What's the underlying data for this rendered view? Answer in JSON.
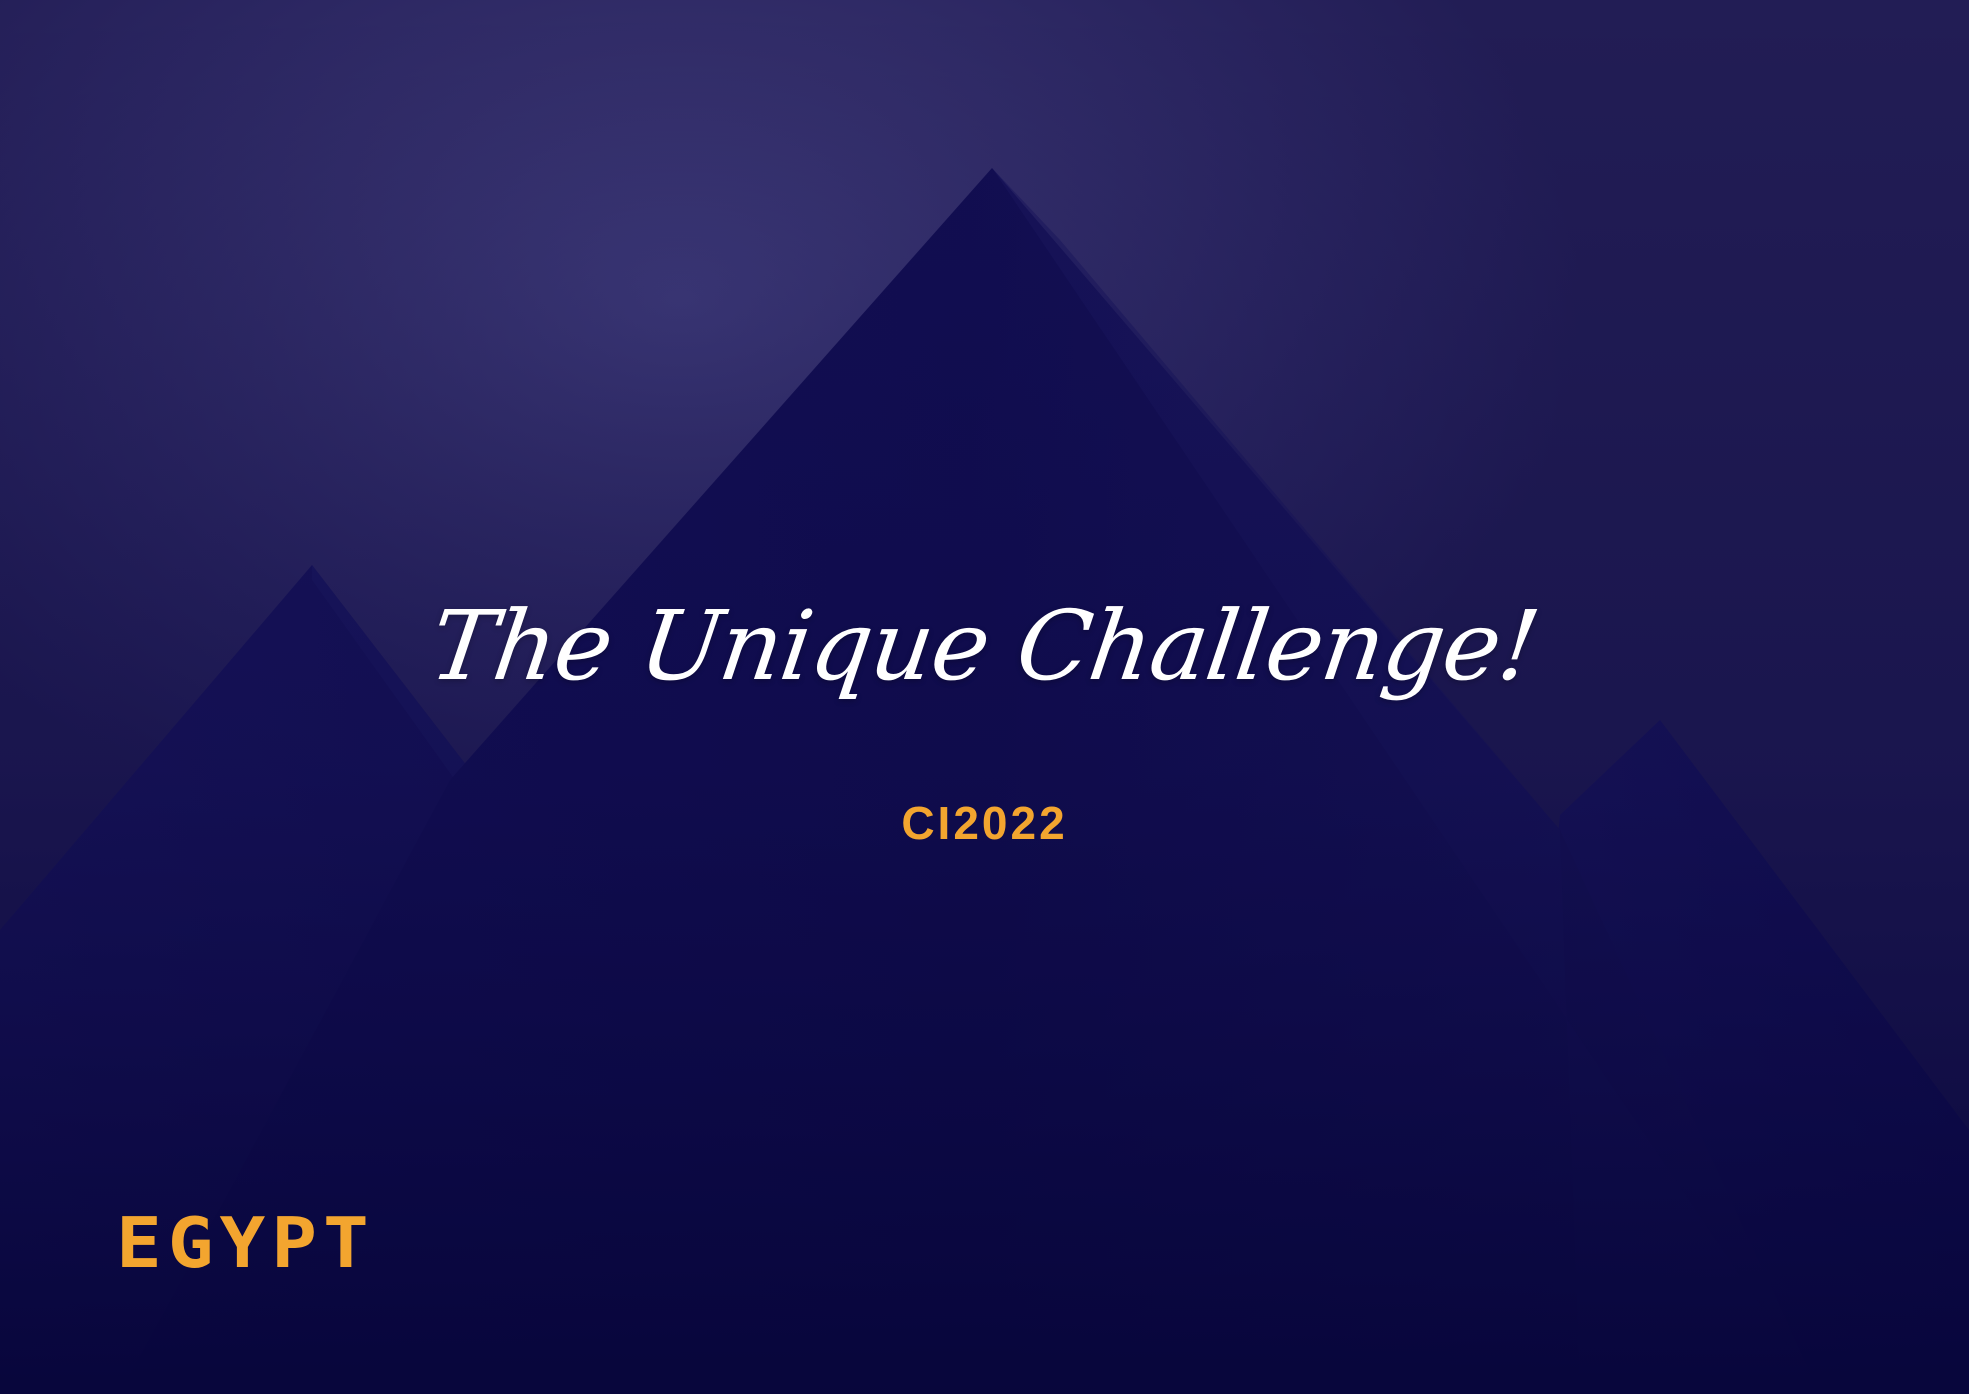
{
  "slide": {
    "headline": "The Unique Challenge!",
    "subtitle": "CI2022",
    "logo_text": "EGYPT"
  },
  "colors": {
    "background": "#2a2560",
    "pyramid": "#100c4c",
    "accent": "#f3a52f",
    "headline": "#ffffff"
  }
}
